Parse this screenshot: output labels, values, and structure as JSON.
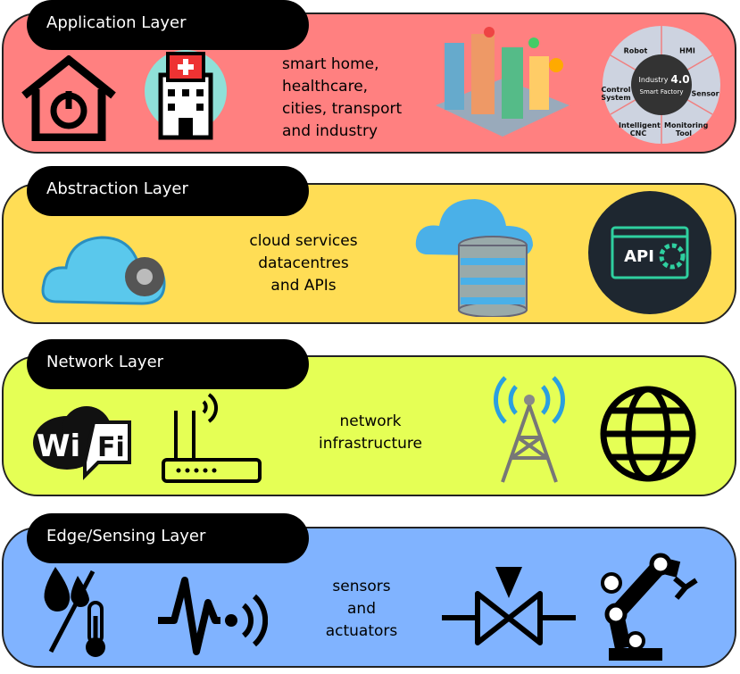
{
  "colors": {
    "application": "#ff8080",
    "abstraction": "#ffdd55",
    "network": "#e5ff55",
    "edge": "#80b3ff",
    "tab": "#000000"
  },
  "layers": [
    {
      "title": "Application Layer",
      "description": [
        "smart home,",
        "healthcare,",
        "cities, transport",
        "and industry"
      ],
      "icons": [
        "smart-home-power-icon",
        "hospital-icon",
        "smart-city-icon",
        "industry-4-smart-factory-icon"
      ],
      "factory_wheel": {
        "center_line1": "Industry",
        "center_big": "4.0",
        "center_line2": "Smart Factory",
        "segments": [
          "Robot",
          "HMI",
          "Sensor",
          "Monitoring Tool",
          "Intelligent CNC",
          "Control System"
        ]
      }
    },
    {
      "title": "Abstraction Layer",
      "description": [
        "cloud services",
        "datacentres",
        "and APIs"
      ],
      "icons": [
        "cloud-gear-icon",
        "cloud-database-icon",
        "api-gear-icon"
      ],
      "api_label": "API"
    },
    {
      "title": "Network Layer",
      "description": [
        "network",
        "infrastructure"
      ],
      "icons": [
        "wifi-logo-icon",
        "router-icon",
        "cell-tower-icon",
        "globe-icon"
      ],
      "wifi_text": [
        "Wi",
        "Fi"
      ]
    },
    {
      "title": "Edge/Sensing Layer",
      "description": [
        "sensors",
        "and",
        "actuators"
      ],
      "icons": [
        "humidity-temperature-icon",
        "signal-sensor-icon",
        "valve-actuator-icon",
        "robot-arm-icon"
      ]
    }
  ]
}
